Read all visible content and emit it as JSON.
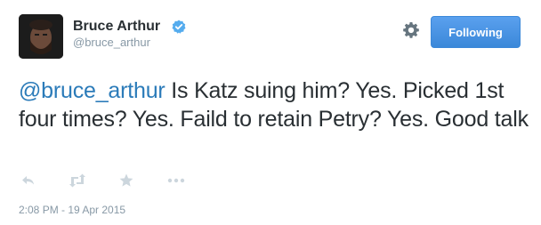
{
  "user": {
    "display_name": "Bruce Arthur",
    "handle": "@bruce_arthur",
    "verified": true
  },
  "follow_button": {
    "label": "Following"
  },
  "tweet": {
    "mention": "@bruce_arthur",
    "text": " Is Katz suing him? Yes. Picked 1st four times? Yes. Faild to retain Petry? Yes. Good talk",
    "timestamp": "2:08 PM - 19 Apr 2015"
  },
  "actions": [
    "reply-icon",
    "retweet-icon",
    "favorite-icon",
    "more-icon"
  ],
  "colors": {
    "link": "#2b7bb9",
    "follow_button": "#4a90e2",
    "muted": "#8899a6",
    "verified": "#55acee"
  }
}
